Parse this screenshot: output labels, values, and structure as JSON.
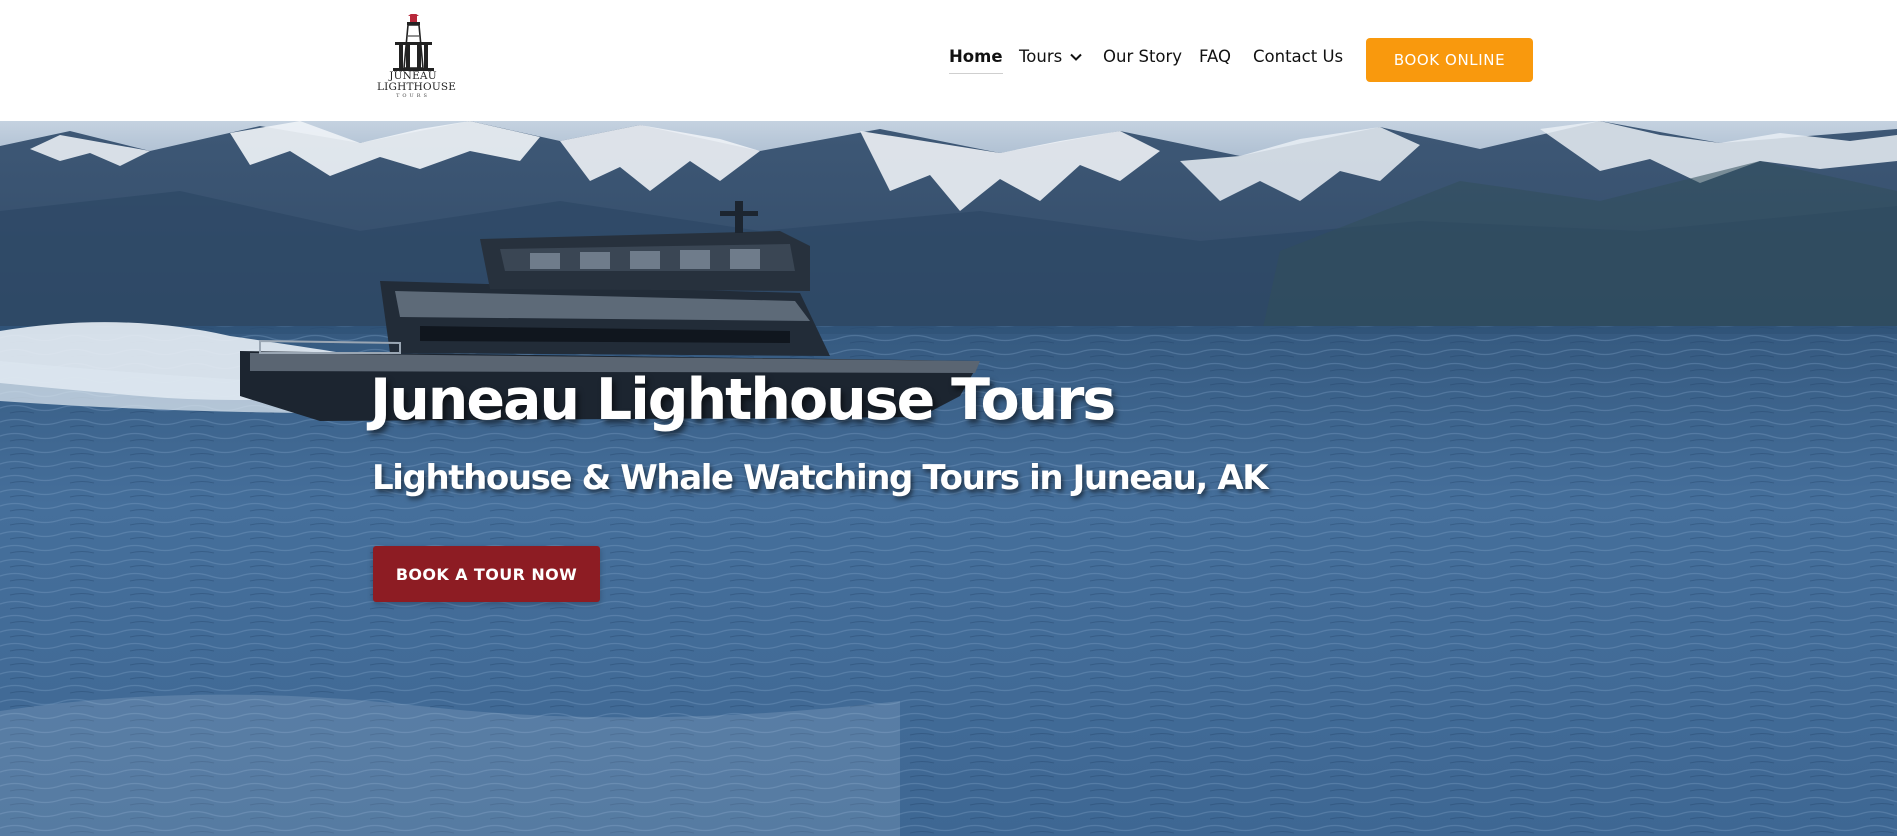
{
  "header": {
    "logo": {
      "line1": "JUNEAU",
      "line2": "LIGHTHOUSE",
      "line3": "TOURS",
      "icon": "lighthouse-icon"
    },
    "nav": [
      {
        "label": "Home",
        "active": true
      },
      {
        "label": "Tours",
        "icon": "chevron-down-icon"
      },
      {
        "label": "Our Story"
      },
      {
        "label": "FAQ"
      },
      {
        "label": "Contact Us"
      }
    ],
    "book_button": "BOOK ONLINE"
  },
  "hero": {
    "title": "Juneau Lighthouse Tours",
    "subtitle": "Lighthouse & Whale Watching Tours in Juneau, AK",
    "cta": "BOOK A TOUR NOW",
    "background": "boat-on-water-with-snowy-mountains"
  },
  "colors": {
    "accent_orange": "#f9990d",
    "cta_red": "#8d1c23",
    "water_blue": "#3f6e9e",
    "mountain_blue": "#2f4a68",
    "text_dark": "#111111"
  }
}
